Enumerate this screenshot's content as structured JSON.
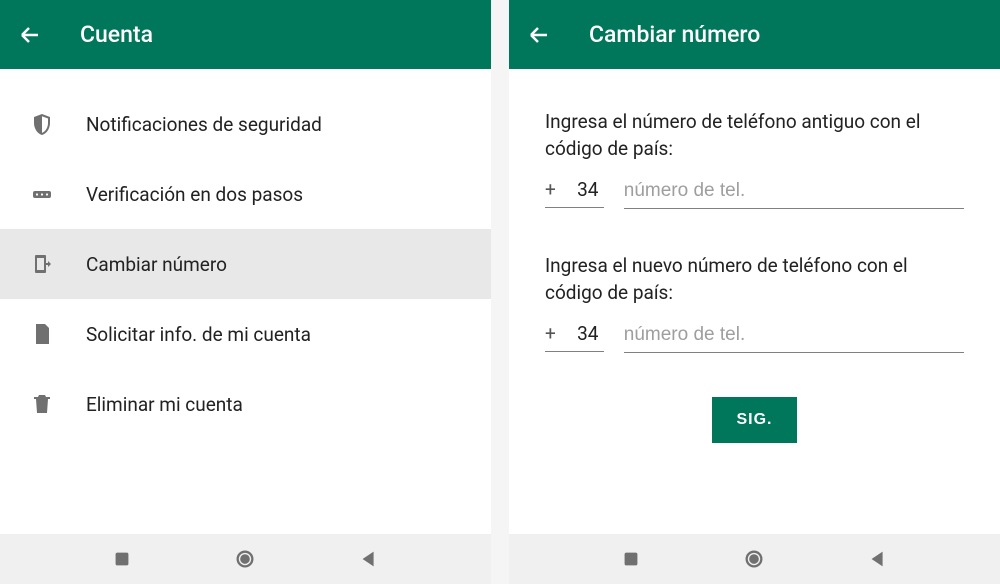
{
  "left": {
    "header": {
      "title": "Cuenta"
    },
    "menu": [
      {
        "label": "Notificaciones de seguridad",
        "selected": false
      },
      {
        "label": "Verificación en dos pasos",
        "selected": false
      },
      {
        "label": "Cambiar número",
        "selected": true
      },
      {
        "label": "Solicitar info. de mi cuenta",
        "selected": false
      },
      {
        "label": "Eliminar mi cuenta",
        "selected": false
      }
    ]
  },
  "right": {
    "header": {
      "title": "Cambiar número"
    },
    "form": {
      "old_label": "Ingresa el número de teléfono antiguo con el código de país:",
      "new_label": "Ingresa el nuevo número de teléfono con el código de país:",
      "plus": "+",
      "country_code_old": "34",
      "country_code_new": "34",
      "phone_placeholder": "número de tel.",
      "button_label": "SIG."
    }
  }
}
